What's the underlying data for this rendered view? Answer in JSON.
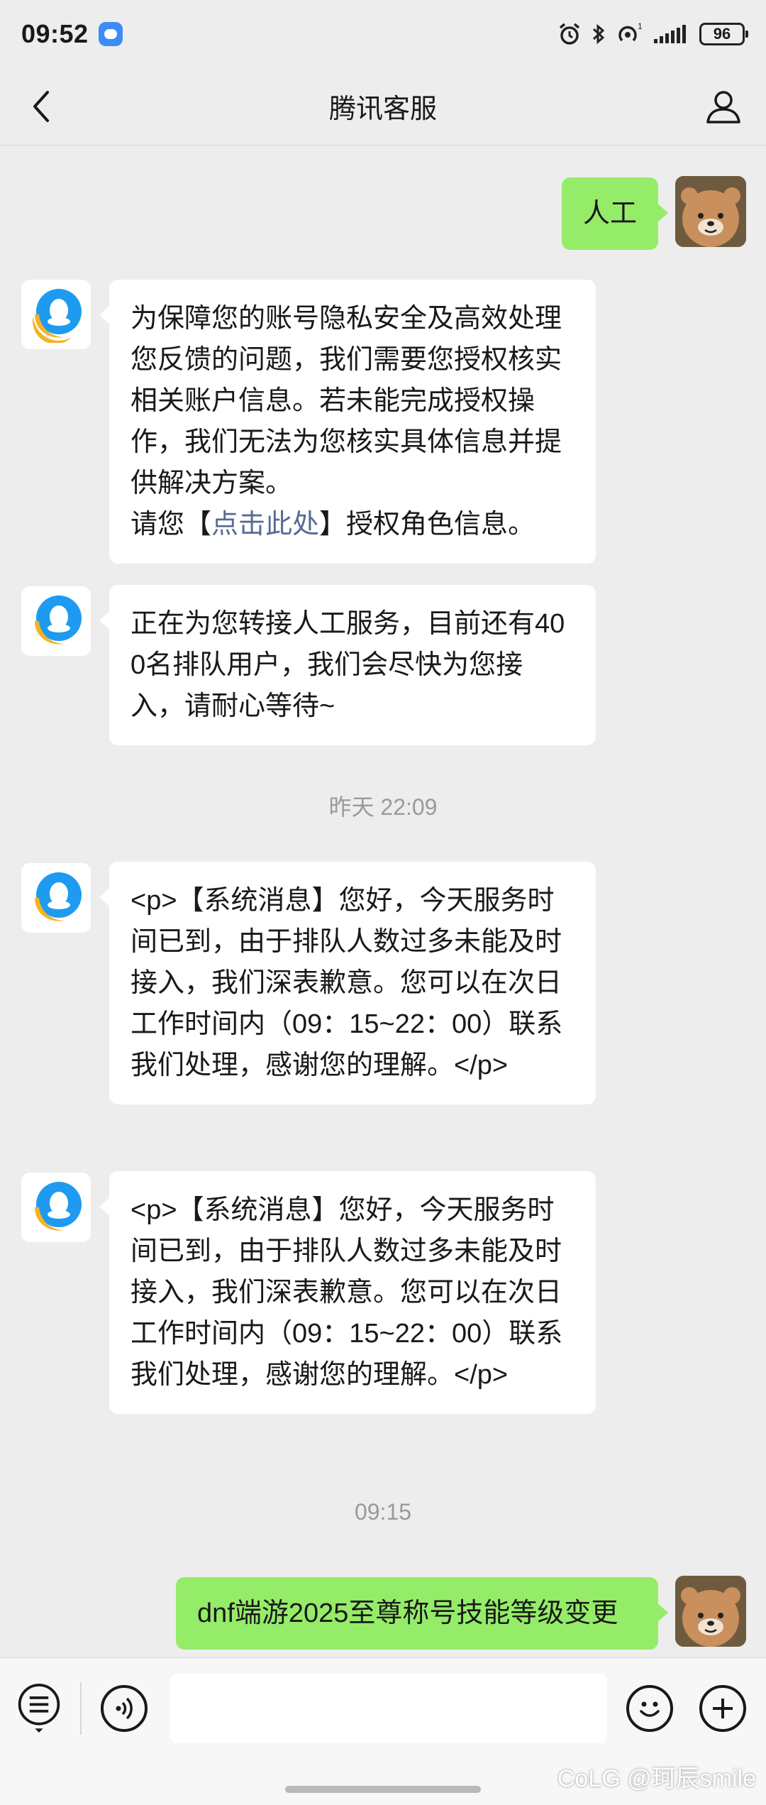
{
  "status_bar": {
    "time": "09:52",
    "battery": "96"
  },
  "header": {
    "title": "腾讯客服"
  },
  "messages": [
    {
      "text": "人工"
    },
    {
      "text_before": "为保障您的账号隐私安全及高效处理您反馈的问题，我们需要您授权核实相关账户信息。若未能完成授权操作，我们无法为您核实具体信息并提供解决方案。",
      "text_prompt": "请您【",
      "link": "点击此处",
      "text_after": "】授权角色信息。"
    },
    {
      "text": "正在为您转接人工服务，目前还有400名排队用户，我们会尽快为您接入，请耐心等待~"
    },
    {
      "time": "昨天 22:09"
    },
    {
      "text": "<p>【系统消息】您好，今天服务时间已到，由于排队人数过多未能及时接入，我们深表歉意。您可以在次日工作时间内（09：15~22：00）联系我们处理，感谢您的理解。</p>"
    },
    {
      "text": "<p>【系统消息】您好，今天服务时间已到，由于排队人数过多未能及时接入，我们深表歉意。您可以在次日工作时间内（09：15~22：00）联系我们处理，感谢您的理解。</p>"
    },
    {
      "time": "09:15"
    },
    {
      "text": "dnf端游2025至尊称号技能等级变更"
    }
  ],
  "input_bar": {
    "placeholder": ""
  },
  "watermark": "CoLG @珂辰smile",
  "icons": {
    "back": "chevron-left-icon",
    "profile": "person-icon",
    "menu": "list-menu-icon",
    "voice": "voice-icon",
    "emoji": "emoji-icon",
    "add": "plus-icon"
  },
  "colors": {
    "background": "#ededed",
    "outgoing_bubble": "#95ec69",
    "incoming_bubble": "#ffffff",
    "link": "#576b95"
  }
}
